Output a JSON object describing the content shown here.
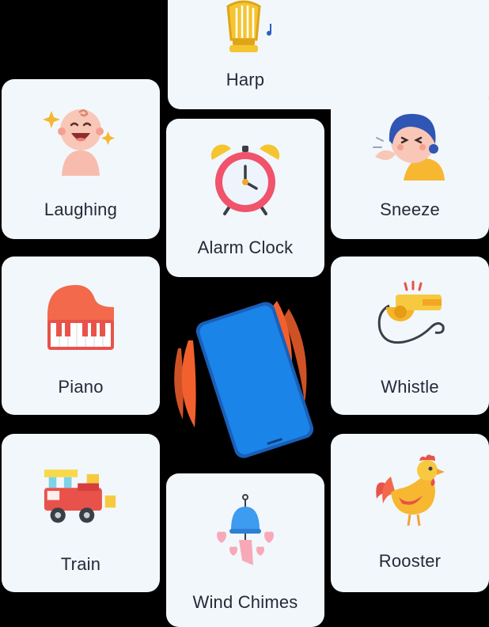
{
  "sounds": [
    {
      "id": "harp",
      "label": "Harp",
      "icon": "harp-icon"
    },
    {
      "id": "laughing",
      "label": "Laughing",
      "icon": "laughing-baby-icon"
    },
    {
      "id": "alarm-clock",
      "label": "Alarm Clock",
      "icon": "alarm-clock-icon"
    },
    {
      "id": "sneeze",
      "label": "Sneeze",
      "icon": "sneeze-icon"
    },
    {
      "id": "piano",
      "label": "Piano",
      "icon": "piano-icon"
    },
    {
      "id": "whistle",
      "label": "Whistle",
      "icon": "whistle-icon"
    },
    {
      "id": "train",
      "label": "Train",
      "icon": "train-icon"
    },
    {
      "id": "rooster",
      "label": "Rooster",
      "icon": "rooster-icon"
    },
    {
      "id": "wind-chimes",
      "label": "Wind Chimes",
      "icon": "wind-chimes-icon"
    }
  ],
  "center": {
    "icon": "vibrating-phone-icon"
  },
  "colors": {
    "background": "#000000",
    "card": "#f2f7fc",
    "text": "#222b38",
    "phone": "#1a7fe0",
    "vibration": "#f2602d"
  }
}
